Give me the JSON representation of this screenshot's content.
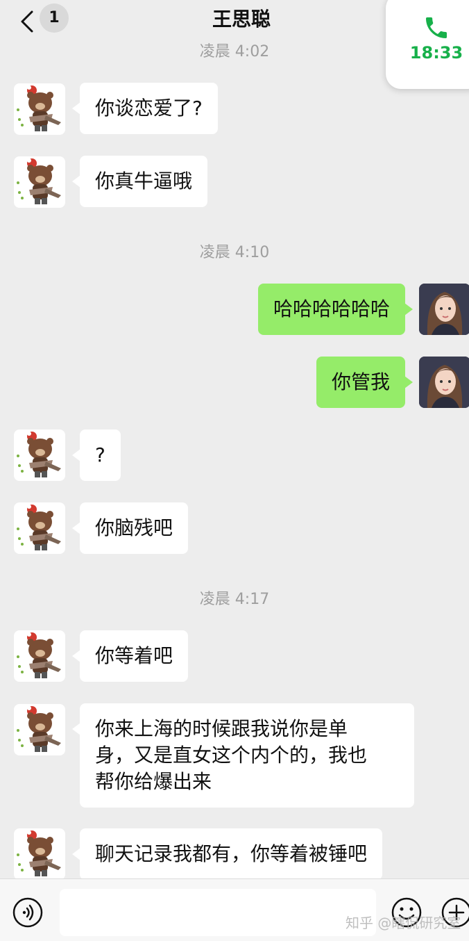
{
  "header": {
    "back_count": "1",
    "title": "王思聪",
    "call_time": "18:33"
  },
  "timestamps": [
    "凌晨 4:02",
    "凌晨 4:10",
    "凌晨 4:17"
  ],
  "messages": [
    {
      "sender": "other",
      "text": "你谈恋爱了?"
    },
    {
      "sender": "other",
      "text": "你真牛逼哦"
    },
    {
      "sender": "me",
      "text": "哈哈哈哈哈哈"
    },
    {
      "sender": "me",
      "text": "你管我"
    },
    {
      "sender": "other",
      "text": "?"
    },
    {
      "sender": "other",
      "text": "你脑残吧"
    },
    {
      "sender": "other",
      "text": "你等着吧"
    },
    {
      "sender": "other",
      "text": "你来上海的时候跟我说你是单\n身，又是直女这个内个的，我也\n帮你给爆出来"
    },
    {
      "sender": "other",
      "text": "聊天记录我都有，你等着被锤吧"
    }
  ],
  "input": {
    "value": "",
    "placeholder": ""
  },
  "watermark": "知乎 @瞎侃研究室",
  "colors": {
    "background": "#ededed",
    "bubble_incoming": "#ffffff",
    "bubble_outgoing": "#95ec69",
    "call_green": "#17b04a"
  },
  "icons": [
    "chevron-left-icon",
    "phone-icon",
    "voice-icon",
    "emoji-icon",
    "plus-icon"
  ]
}
